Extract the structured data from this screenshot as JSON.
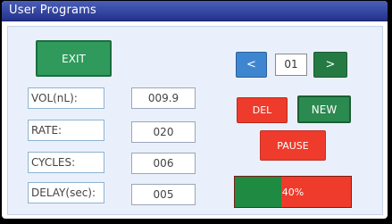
{
  "window": {
    "title": "User Programs"
  },
  "exit": {
    "label": "EXIT"
  },
  "fields": [
    {
      "label": "VOL(nL):",
      "value": "009.9"
    },
    {
      "label": "RATE:",
      "value": "020"
    },
    {
      "label": "CYCLES:",
      "value": "006"
    },
    {
      "label": "DELAY(sec):",
      "value": "005"
    }
  ],
  "program": {
    "prev_label": "<",
    "number": "01",
    "next_label": ">"
  },
  "actions": {
    "del_label": "DEL",
    "new_label": "NEW",
    "pause_label": "PAUSE"
  },
  "progress": {
    "label": "40%",
    "fraction": 0.4
  },
  "colors": {
    "title_bar": "#24328c",
    "green_button": "#2f9a5c",
    "blue_button": "#3f86d0",
    "red_button": "#ef3b2c",
    "progress_fill": "#1f8a42"
  }
}
